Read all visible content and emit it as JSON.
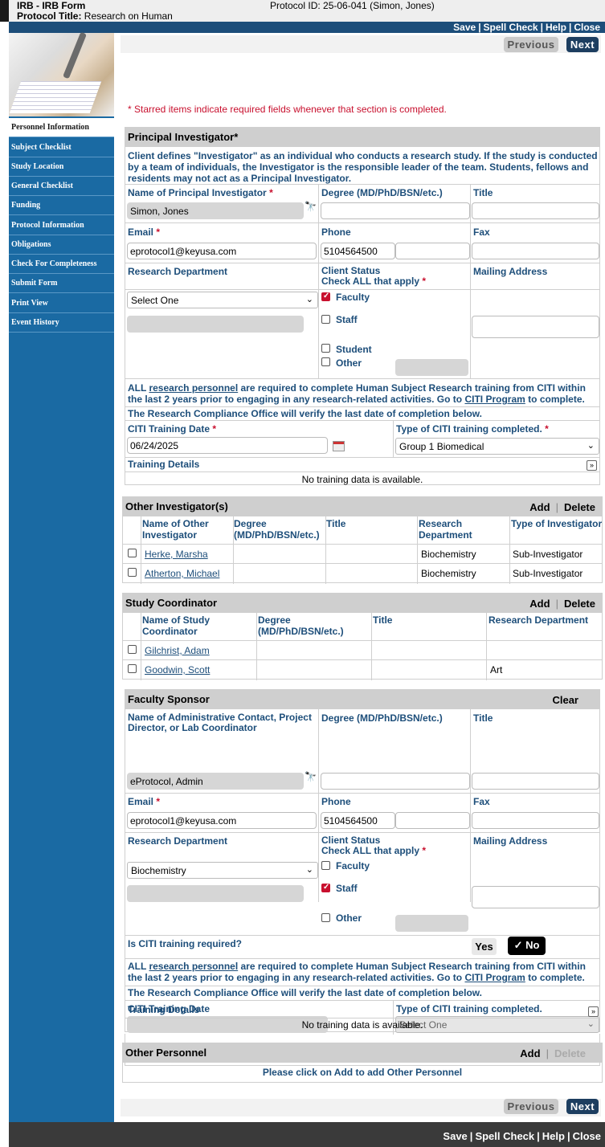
{
  "header": {
    "app": "IRB - IRB Form",
    "protocol_title_label": "Protocol Title:",
    "protocol_title": "Research on Human",
    "protocol_id": "Protocol ID: 25-06-041 (Simon, Jones)"
  },
  "toolbar": {
    "save": "Save",
    "spell": "Spell Check",
    "help": "Help",
    "close": "Close",
    "sep": "|"
  },
  "nav": [
    "Personnel Information",
    "Subject Checklist",
    "Study Location",
    "General Checklist",
    "Funding",
    "Protocol Information",
    "Obligations",
    "Check For Completeness",
    "Submit Form",
    "Print View",
    "Event History"
  ],
  "buttons": {
    "previous": "Previous",
    "next": "Next",
    "add": "Add",
    "delete": "Delete",
    "clear": "Clear",
    "yes": "Yes",
    "no": "No"
  },
  "required_note": "* Starred items indicate required fields whenever that section is completed.",
  "pi": {
    "title": "Principal Investigator*",
    "desc": "Client defines \"Investigator\" as an individual who conducts a research study. If the study is conducted by a team of individuals, the Investigator is the responsible leader of the team. Students, fellows and residents may not act as a Principal Investigator.",
    "name_label": "Name of Principal Investigator",
    "name": "Simon, Jones",
    "degree_label": "Degree (MD/PhD/BSN/etc.)",
    "title_label": "Title",
    "email_label": "Email",
    "email": "eprotocol1@keyusa.com",
    "phone_label": "Phone",
    "phone": "5104564500",
    "fax_label": "Fax",
    "dept_label": "Research Department",
    "dept": "Select One",
    "status_label": "Client Status",
    "status_sub": "Check ALL that apply",
    "mailing_label": "Mailing Address",
    "faculty": "Faculty",
    "staff": "Staff",
    "student": "Student",
    "other": "Other",
    "citi_note_1": "ALL ",
    "citi_link": "research personnel",
    "citi_note_2": " are required to complete Human Subject Research training from CITI within the last 2 years prior to engaging in any research-related activities. Go to ",
    "citi_prog": "CITI Program",
    "citi_note_3": " to complete.",
    "verify": "The Research Compliance Office will verify the last date of completion below.",
    "citi_date_label": "CITI Training Date",
    "citi_date": "06/24/2025",
    "citi_type_label": "Type of CITI training completed.",
    "citi_type": "Group 1 Biomedical",
    "training_label": "Training Details",
    "no_training": "No training data is available."
  },
  "other_inv": {
    "title": "Other Investigator(s)",
    "cols": [
      "Name of Other Investigator",
      "Degree (MD/PhD/BSN/etc.)",
      "Title",
      "Research Department",
      "Type of Investigator"
    ],
    "rows": [
      {
        "name": "Herke, Marsha",
        "dept": "Biochemistry",
        "type": "Sub-Investigator"
      },
      {
        "name": "Atherton, Michael",
        "dept": "Biochemistry",
        "type": "Sub-Investigator"
      }
    ]
  },
  "coord": {
    "title": "Study Coordinator",
    "cols": [
      "Name of Study Coordinator",
      "Degree (MD/PhD/BSN/etc.)",
      "Title",
      "Research Department"
    ],
    "rows": [
      {
        "name": "Gilchrist, Adam",
        "dept": ""
      },
      {
        "name": "Goodwin, Scott",
        "dept": "Art"
      }
    ]
  },
  "sponsor": {
    "title": "Faculty Sponsor",
    "name_label": "Name of Administrative Contact, Project Director, or Lab Coordinator",
    "name": "eProtocol, Admin",
    "email": "eprotocol1@keyusa.com",
    "phone": "5104564500",
    "dept": "Biochemistry",
    "citi_required": "Is CITI training required?",
    "citi_date_label": "CITI Training Date",
    "citi_type_label": "Type of CITI training completed.",
    "citi_type": "Select One"
  },
  "other_personnel": {
    "title": "Other Personnel",
    "msg": "Please click on Add to add Other Personnel"
  }
}
